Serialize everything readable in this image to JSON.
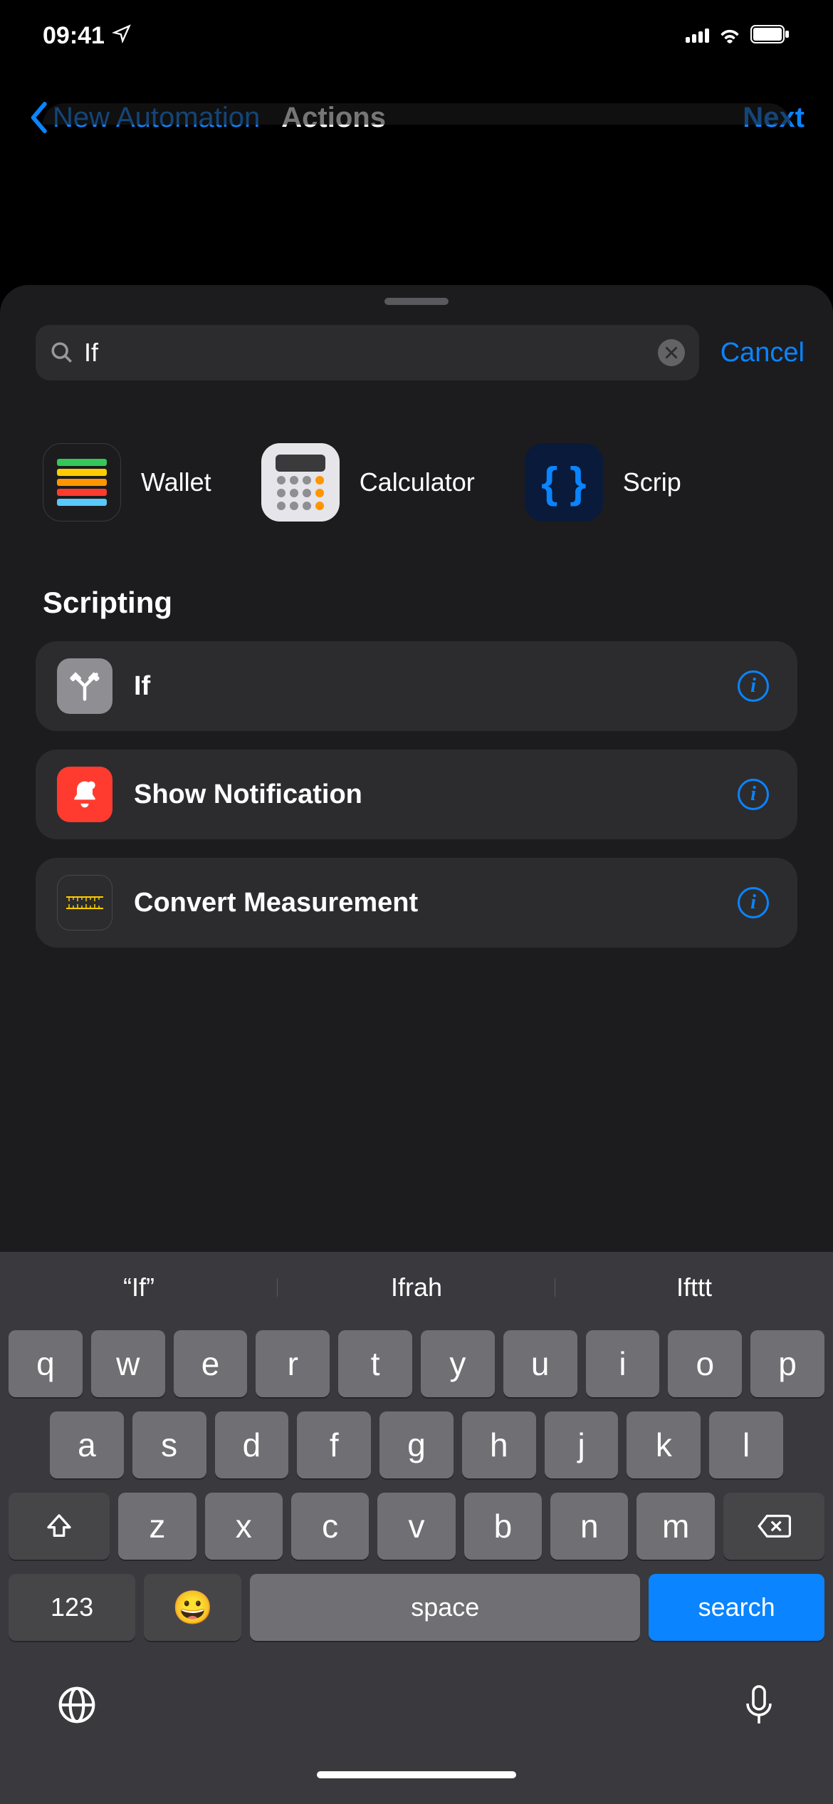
{
  "status": {
    "time": "09:41"
  },
  "nav": {
    "back_label": "New Automation",
    "title": "Actions",
    "next_label": "Next"
  },
  "search": {
    "value": "If",
    "cancel_label": "Cancel"
  },
  "apps": [
    {
      "id": "wallet",
      "label": "Wallet"
    },
    {
      "id": "calculator",
      "label": "Calculator"
    },
    {
      "id": "scripting",
      "label": "Scrip"
    }
  ],
  "section": {
    "title": "Scripting"
  },
  "actions": [
    {
      "id": "if",
      "label": "If",
      "icon_bg": "#8e8e93",
      "icon_glyph": "branch"
    },
    {
      "id": "show-notification",
      "label": "Show Notification",
      "icon_bg": "#ff3b30",
      "icon_glyph": "bell"
    },
    {
      "id": "convert-measurement",
      "label": "Convert Measurement",
      "icon_bg": "#2c2c2e",
      "icon_glyph": "ruler"
    }
  ],
  "suggestions": [
    "“If”",
    "Ifrah",
    "Ifttt"
  ],
  "keyboard": {
    "row1": [
      "q",
      "w",
      "e",
      "r",
      "t",
      "y",
      "u",
      "i",
      "o",
      "p"
    ],
    "row2": [
      "a",
      "s",
      "d",
      "f",
      "g",
      "h",
      "j",
      "k",
      "l"
    ],
    "row3": [
      "z",
      "x",
      "c",
      "v",
      "b",
      "n",
      "m"
    ],
    "numbers_label": "123",
    "space_label": "space",
    "search_label": "search"
  }
}
